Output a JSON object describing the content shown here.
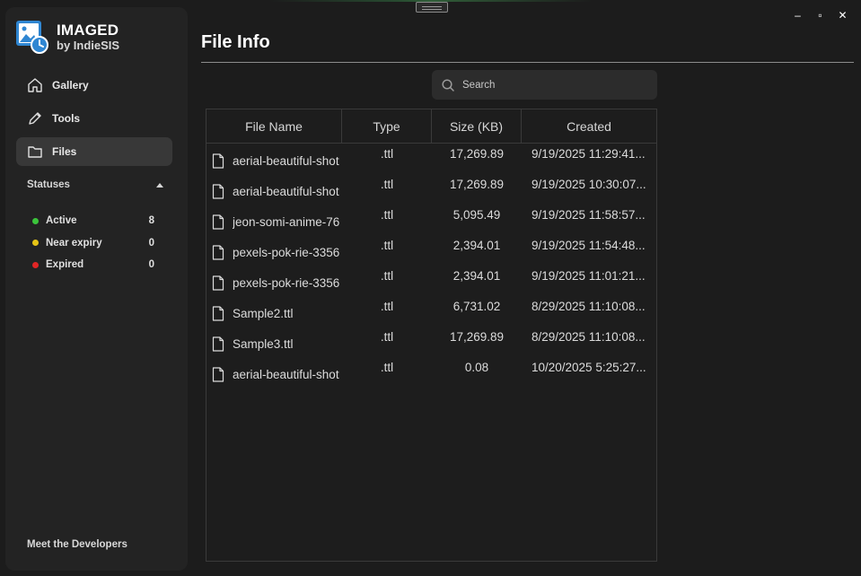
{
  "window": {
    "controls": {
      "minimize": "–",
      "maximize": "▫",
      "close": "✕"
    }
  },
  "brand": {
    "title": "IMAGED",
    "subtitle": "by IndieSIS",
    "logo_icon": "image-clock-icon"
  },
  "sidebar": {
    "items": [
      {
        "label": "Gallery",
        "icon": "home-icon",
        "active": false
      },
      {
        "label": "Tools",
        "icon": "pencil-icon",
        "active": false
      },
      {
        "label": "Files",
        "icon": "folder-icon",
        "active": true
      }
    ],
    "statuses": {
      "title": "Statuses",
      "items": [
        {
          "label": "Active",
          "count": "8",
          "color": "#3bc43b"
        },
        {
          "label": "Near expiry",
          "count": "0",
          "color": "#e6c416"
        },
        {
          "label": "Expired",
          "count": "0",
          "color": "#e02525"
        }
      ]
    },
    "footer_link": "Meet the Developers"
  },
  "main": {
    "title": "File Info",
    "search": {
      "placeholder": "Search",
      "value": ""
    },
    "table": {
      "columns": [
        "File Name",
        "Type",
        "Size (KB)",
        "Created"
      ],
      "rows": [
        {
          "name": "aerial-beautiful-shot",
          "type": ".ttl",
          "size": "17,269.89",
          "created": "9/19/2025 11:29:41..."
        },
        {
          "name": "aerial-beautiful-shot",
          "type": ".ttl",
          "size": "17,269.89",
          "created": "9/19/2025 10:30:07..."
        },
        {
          "name": "jeon-somi-anime-76",
          "type": ".ttl",
          "size": "5,095.49",
          "created": "9/19/2025 11:58:57..."
        },
        {
          "name": "pexels-pok-rie-3356",
          "type": ".ttl",
          "size": "2,394.01",
          "created": "9/19/2025 11:54:48..."
        },
        {
          "name": "pexels-pok-rie-3356",
          "type": ".ttl",
          "size": "2,394.01",
          "created": "9/19/2025 11:01:21..."
        },
        {
          "name": "Sample2.ttl",
          "type": ".ttl",
          "size": "6,731.02",
          "created": "8/29/2025 11:10:08..."
        },
        {
          "name": "Sample3.ttl",
          "type": ".ttl",
          "size": "17,269.89",
          "created": "8/29/2025 11:10:08..."
        },
        {
          "name": "aerial-beautiful-shot",
          "type": ".ttl",
          "size": "0.08",
          "created": "10/20/2025 5:25:27..."
        }
      ]
    }
  },
  "colors": {
    "background": "#1c1c1c",
    "sidebar": "#232323",
    "active_nav": "#383838",
    "logo_blue": "#3a8fd6"
  }
}
